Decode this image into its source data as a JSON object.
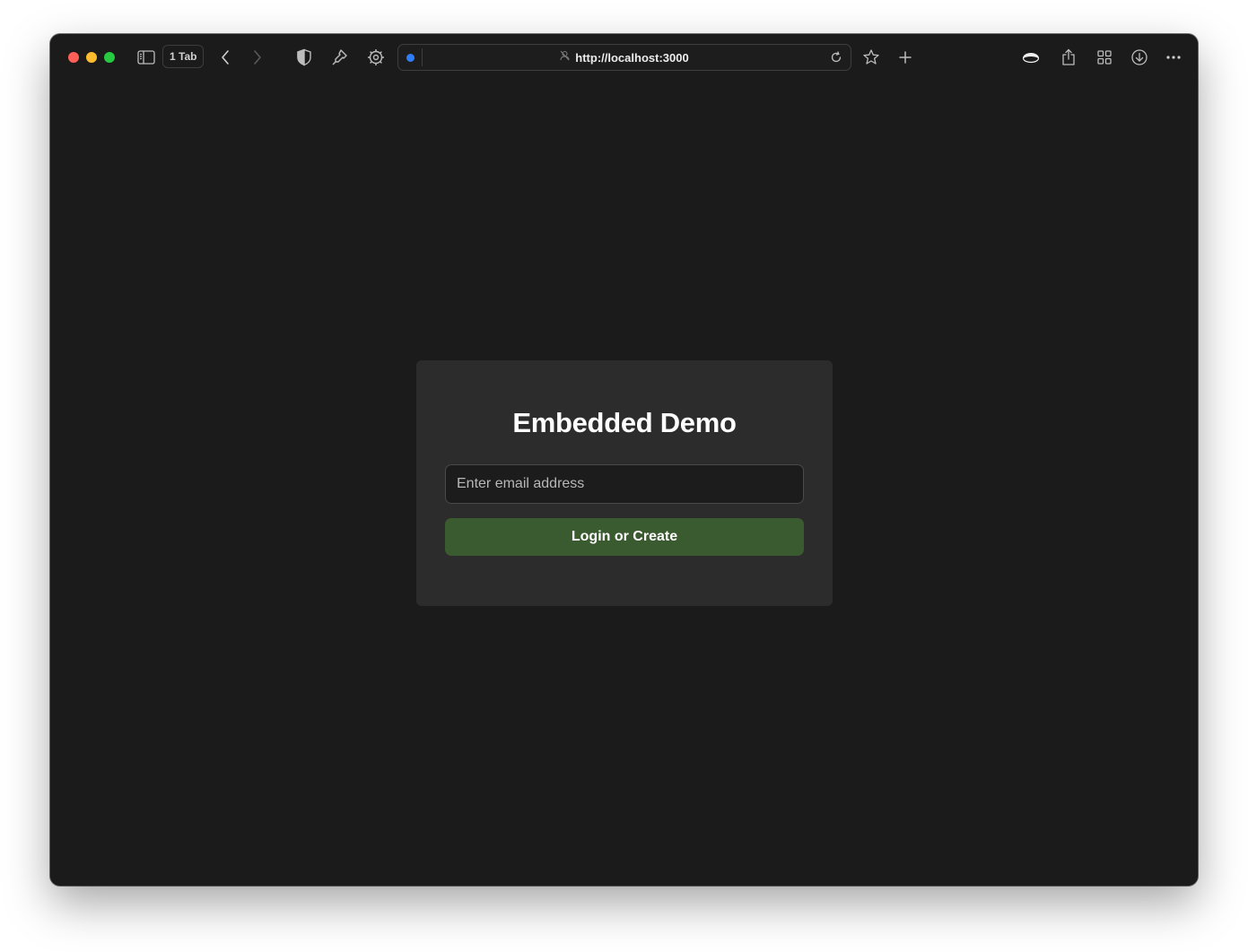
{
  "browser": {
    "tab_count_label": "1 Tab",
    "url": "http://localhost:3000",
    "colors": {
      "close": "#ff5f57",
      "minimize": "#febc2e",
      "maximize": "#28c840",
      "status_dot": "#2f7ef7"
    },
    "toolbar_icons": [
      "sidebar-icon",
      "back-icon",
      "forward-icon",
      "shield-icon",
      "extension-icon",
      "settings-icon",
      "reload-icon",
      "bookmark-star-icon",
      "new-tab-icon",
      "profile-icon",
      "share-icon",
      "tab-overview-icon",
      "downloads-icon",
      "more-icon"
    ]
  },
  "page": {
    "title": "Embedded Demo",
    "email_placeholder": "Enter email address",
    "email_value": "",
    "submit_label": "Login or Create",
    "colors": {
      "background": "#1b1b1b",
      "card": "#2c2c2c",
      "button": "#3a5a2f"
    }
  }
}
